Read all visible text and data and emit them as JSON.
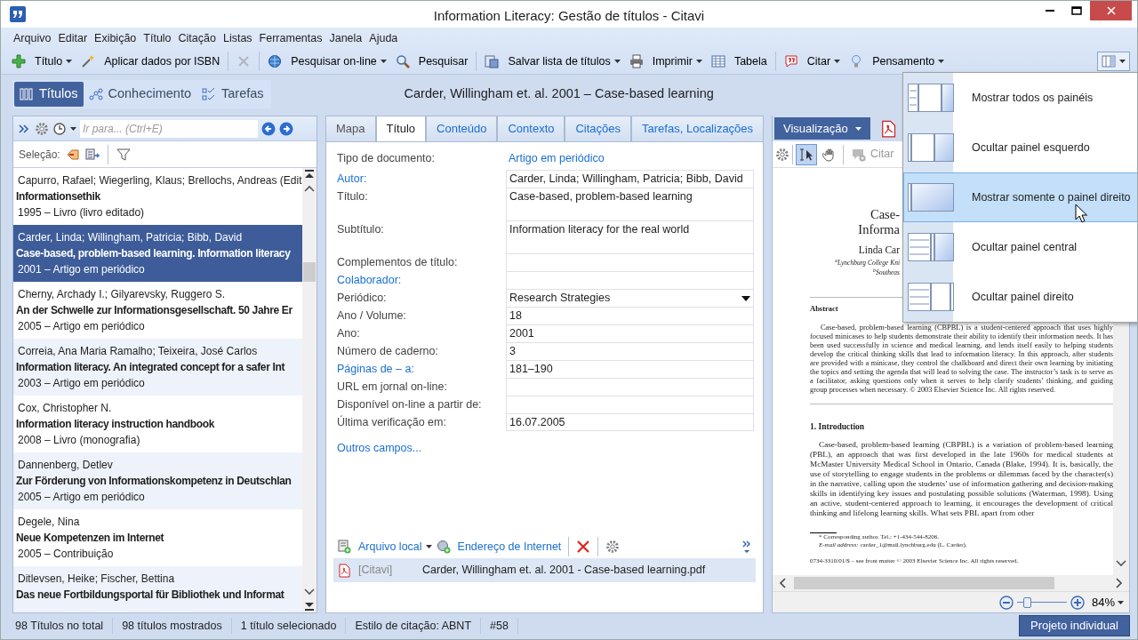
{
  "window": {
    "title": "Information Literacy: Gestão de títulos - Citavi"
  },
  "menu": [
    "Arquivo",
    "Editar",
    "Exibição",
    "Título",
    "Citação",
    "Listas",
    "Ferramentas",
    "Janela",
    "Ajuda"
  ],
  "toolbar": [
    {
      "kind": "button",
      "label": "Título",
      "dropdown": true,
      "disabled": false
    },
    {
      "kind": "button",
      "label": "Aplicar dados por ISBN",
      "dropdown": false,
      "disabled": false
    },
    {
      "kind": "separator"
    },
    {
      "kind": "button",
      "dropdown": false,
      "disabled": true
    },
    {
      "kind": "separator"
    },
    {
      "kind": "button",
      "label": "Pesquisar on-line",
      "dropdown": true,
      "disabled": false
    },
    {
      "kind": "button",
      "label": "Pesquisar",
      "dropdown": false,
      "disabled": false
    },
    {
      "kind": "separator"
    },
    {
      "kind": "button",
      "label": "Salvar lista de títulos",
      "dropdown": true,
      "disabled": false
    },
    {
      "kind": "button",
      "label": "Imprimir",
      "dropdown": true,
      "disabled": false
    },
    {
      "kind": "button",
      "label": "Tabela",
      "dropdown": false,
      "disabled": false
    },
    {
      "kind": "separator"
    },
    {
      "kind": "button",
      "label": "Citar",
      "dropdown": true,
      "disabled": false
    },
    {
      "kind": "button",
      "label": "Pensamento",
      "dropdown": true,
      "disabled": false
    }
  ],
  "nav_tabs": [
    {
      "label": "Títulos",
      "selected": true
    },
    {
      "label": "Conhecimento",
      "selected": false
    },
    {
      "label": "Tarefas",
      "selected": false
    }
  ],
  "record_title": "Carder, Willingham et. al. 2001 – Case-based learning",
  "left_panel": {
    "goto_placeholder": "Ir para... (Ctrl+E)",
    "selection_label": "Seleção:",
    "items": [
      {
        "author": "Capurro, Rafael; Wiegerling, Klaus; Brellochs, Andreas (Edit",
        "title": "Informationsethik",
        "info": "1995 – Livro (livro editado)",
        "selected": false
      },
      {
        "author": "Carder, Linda; Willingham, Patricia; Bibb, David",
        "title": "Case-based, problem-based learning. Information literacy",
        "info": "2001 – Artigo em periódico",
        "selected": true
      },
      {
        "author": "Cherny, Archady I.; Gilyarevsky, Ruggero S.",
        "title": "An der Schwelle zur Informationsgesellschaft. 50 Jahre Er",
        "info": "2005 – Artigo em periódico",
        "selected": false
      },
      {
        "author": "Correia, Ana Maria Ramalho; Teixeira, José Carlos",
        "title": "Information literacy. An integrated concept for a safer Int",
        "info": "2003 – Artigo em periódico",
        "selected": false
      },
      {
        "author": "Cox, Christopher N.",
        "title": "Information literacy instruction handbook",
        "info": "2008 – Livro (monografia)",
        "selected": false
      },
      {
        "author": "Dannenberg, Detlev",
        "title": "Zur Förderung von Informationskompetenz in Deutschlan",
        "info": "2005 – Artigo em periódico",
        "selected": false
      },
      {
        "author": "Degele, Nina",
        "title": "Neue Kompetenzen im Internet",
        "info": "2005 – Contribuição",
        "selected": false
      },
      {
        "author": "Ditlevsen, Heike; Fischer, Bettina",
        "title": "Das neue Fortbildungsportal für Bibliothek und Informat",
        "selected": false
      }
    ]
  },
  "editor": {
    "tabs": [
      {
        "label": "Mapa",
        "selected": false,
        "disabled": true
      },
      {
        "label": "Título",
        "selected": true,
        "disabled": false
      },
      {
        "label": "Conteúdo",
        "selected": false,
        "disabled": false
      },
      {
        "label": "Contexto",
        "selected": false,
        "disabled": false
      },
      {
        "label": "Citações",
        "selected": false,
        "disabled": false
      },
      {
        "label": "Tarefas, Localizações",
        "selected": false,
        "disabled": false
      }
    ],
    "fields": [
      {
        "kind": "link",
        "label": "Tipo de documento:",
        "value": "Artigo em periódico",
        "link": false
      },
      {
        "kind": "text",
        "label": "Autor:",
        "value": "Carder, Linda; Willingham, Patricia; Bibb, David",
        "link": true
      },
      {
        "kind": "multiline",
        "label": "Título:",
        "value": "Case-based, problem-based learning",
        "link": false
      },
      {
        "kind": "multiline",
        "label": "Subtítulo:",
        "value": "Information literacy for the real world",
        "link": false
      },
      {
        "kind": "text",
        "label": "Complementos de título:",
        "link": false
      },
      {
        "kind": "text",
        "label": "Colaborador:",
        "link": true
      },
      {
        "kind": "dropdown",
        "label": "Periódico:",
        "value": "Research Strategies",
        "link": false
      },
      {
        "kind": "text",
        "label": "Ano / Volume:",
        "value": "18",
        "link": false
      },
      {
        "kind": "text",
        "label": "Ano:",
        "value": "2001",
        "link": false
      },
      {
        "kind": "text",
        "label": "Número de caderno:",
        "value": "3",
        "link": false
      },
      {
        "kind": "text",
        "label": "Páginas de – a:",
        "value": "181–190",
        "link": true
      },
      {
        "kind": "text",
        "label": "URL em jornal on-line:",
        "link": false
      },
      {
        "kind": "text",
        "label": "Disponível on-line a partir de:",
        "link": false
      },
      {
        "kind": "text",
        "label": "Última verificação em:",
        "value": "16.07.2005",
        "link": false
      }
    ],
    "more_fields": "Outros campos...",
    "attachment_tools": [
      {
        "label": "Arquivo local",
        "dropdown": true
      },
      {
        "label": "Endereço de Internet",
        "dropdown": false
      }
    ],
    "attachments": [
      {
        "source": "[Citavi]",
        "name": "Carder, Willingham et. al. 2001 - Case-based learning.pdf",
        "selected": true
      }
    ]
  },
  "viewer": {
    "view_button": "Visualização",
    "tools": [
      {
        "selected": true
      },
      {
        "selected": false
      }
    ],
    "cite": {
      "label": "Citar",
      "disabled": true
    },
    "pdf": {
      "title_lines": [
        "Case-",
        "Informa"
      ],
      "authors": "Linda Car",
      "affiliations": [
        "$^{a}$Lynchburg College Kni",
        "$^{b}$Southeas"
      ],
      "abstract_heading": "Abstract",
      "abstract": "Case-based, problem-based learning (CBPBL) is a student-centered approach that uses highly focused minicases to help students demonstrate their ability to identify their information needs. It has been used successfully in science and medical learning, and lends itself easily to helping students develop the critical thinking skills that lead to information literacy. In this approach, after students are provided with a minicase, they control the chalkboard and direct their own learning by initiating the topics and setting the agenda that will lead to solving the case. The instructor’s task is to serve as a facilitator, asking questions only when it serves to help clarify students’ thinking, and guiding group processes when necessary. © 2003 Elsevier Science Inc. All rights reserved.",
      "section_heading": "1. Introduction",
      "section_text": "Case-based, problem-based learning (CBPBL) is a variation of problem-based learning (PBL), an approach that was first developed in the late 1960s for medical students at McMaster University Medical School in Ontario, Canada (Blake, 1994). It is, basically, the use of storytelling to engage students in the problems or dilemmas faced by the character(s) in the narrative, calling upon the students’ use of information gathering and decision-making skills in identifying key issues and postulating possible solutions (Waterman, 1998). Using an active, student-centered approach to learning, it encourages the development of critical thinking and lifelong learning skills. What sets PBL apart from other",
      "footnotes": [
        "* Corresponding author. Tel.: +1-434-544-8206.",
        "*E-mail address:* carder_1@mail.lynchburg.edu (L. Carder)."
      ],
      "copyright": "0734-3310/01/$ – see front matter © 2003 Elsevier Science Inc. All rights reserved."
    },
    "zoom": {
      "level": 0.15,
      "reading": "84%"
    }
  },
  "status_bar": [
    "98 Títulos no total",
    "98 títulos mostrados",
    "1 título selecionado",
    "Estilo de citação: ABNT",
    "#58"
  ],
  "project": "Projeto individual",
  "layout_menu": [
    {
      "label": "Mostrar todos os painéis",
      "selected": false
    },
    {
      "label": "Ocultar painel esquerdo",
      "selected": false
    },
    {
      "label": "Mostrar somente o painel direito",
      "selected": true
    },
    {
      "label": "Ocultar painel central",
      "selected": false
    },
    {
      "label": "Ocultar painel direito",
      "selected": false
    }
  ]
}
